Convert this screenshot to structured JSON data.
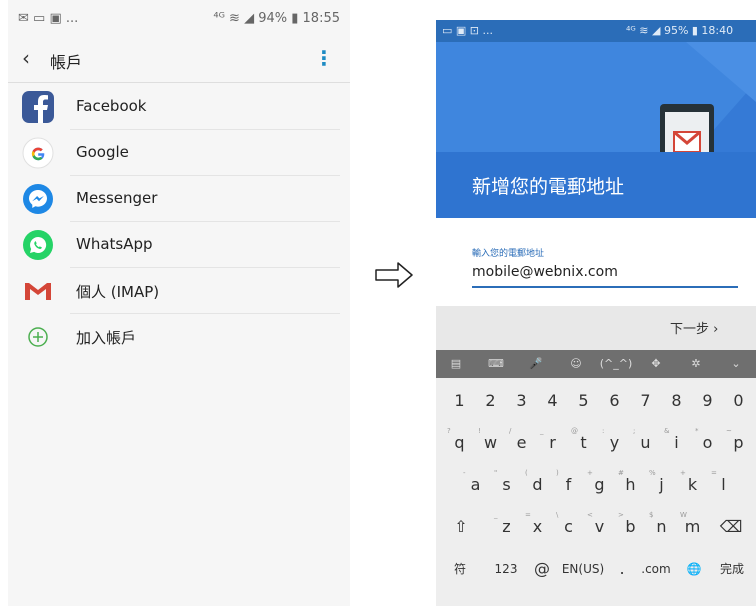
{
  "left": {
    "status_left": "✉ ▭ ▣ ...",
    "status_right": "⁴ᴳ ≋ ◢ 94% ▮ 18:55",
    "title": "帳戶",
    "back_icon": "‹",
    "more_icon": "⋮",
    "accounts": [
      {
        "label": "Facebook",
        "icon": "facebook-icon"
      },
      {
        "label": "Google",
        "icon": "google-icon"
      },
      {
        "label": "Messenger",
        "icon": "messenger-icon"
      },
      {
        "label": "WhatsApp",
        "icon": "whatsapp-icon"
      },
      {
        "label": "個人 (IMAP)",
        "icon": "gmail-icon"
      },
      {
        "label": "加入帳戶",
        "icon": "add-icon"
      }
    ]
  },
  "arrow_icon": "right-arrow-icon",
  "right": {
    "status_left": "▭ ▣ ⊡ ...",
    "status_right": "⁴ᴳ ≋ ◢ 95% ▮ 18:40",
    "heading": "新增您的電郵地址",
    "field_label": "輸入您的電郵地址",
    "field_value": "mobile@webnix.com",
    "next_label": "下一步 ›",
    "toolbar": [
      "▤",
      "⌨",
      "🎤",
      "☺",
      "(^_^)",
      "✥",
      "✲",
      "⌄"
    ],
    "number_row": [
      "1",
      "2",
      "3",
      "4",
      "5",
      "6",
      "7",
      "8",
      "9",
      "0"
    ],
    "row1": [
      "q",
      "w",
      "e",
      "r",
      "t",
      "y",
      "u",
      "i",
      "o",
      "p"
    ],
    "row1_hints": [
      "?",
      "!",
      "/",
      "_",
      "@",
      ":",
      ";",
      "&",
      "*",
      "~"
    ],
    "row2": [
      "a",
      "s",
      "d",
      "f",
      "g",
      "h",
      "j",
      "k",
      "l"
    ],
    "row2_hints": [
      "-",
      "\"",
      "(",
      ")",
      "+",
      "#",
      "%",
      "+",
      "="
    ],
    "row3": [
      "z",
      "x",
      "c",
      "v",
      "b",
      "n",
      "m"
    ],
    "row3_hints": [
      "_",
      "=",
      "\\",
      "<",
      ">",
      "$",
      "W"
    ],
    "bottom": {
      "sym": "符",
      "num": "123",
      "at": "@",
      "space": "EN(US)",
      "dot": ".",
      "com": ".com",
      "globe": "🌐",
      "done": "完成"
    },
    "shift": "⇧",
    "backspace": "⌫"
  },
  "colors": {
    "accent": "#2b6db8",
    "hero": "#3f86de",
    "facebook": "#3b5998",
    "whatsapp": "#25d366",
    "gmail": "#d44638"
  }
}
